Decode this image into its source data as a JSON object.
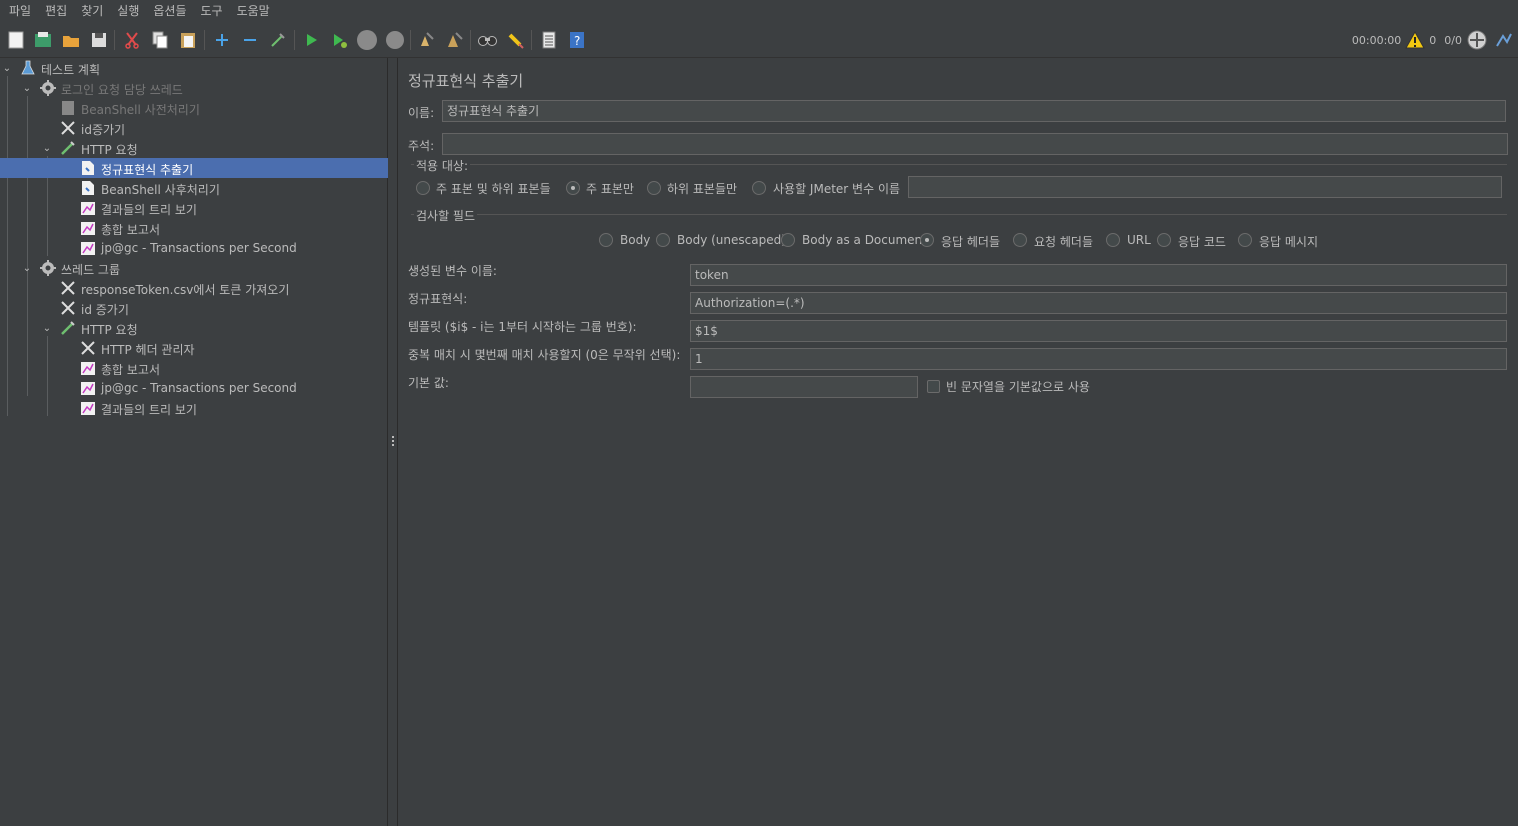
{
  "menu": [
    "파일",
    "편집",
    "찾기",
    "실행",
    "옵션들",
    "도구",
    "도움말"
  ],
  "status": {
    "timer": "00:00:00",
    "warnings": "0",
    "threads": "0/0"
  },
  "tree": [
    {
      "label": "테스트 계획",
      "icon": "flask-icon"
    },
    {
      "label": "로그인 요청 담당 쓰레드",
      "icon": "gear-icon"
    },
    {
      "label": "BeanShell 사전처리기",
      "icon": "script-icon"
    },
    {
      "label": "id증가기",
      "icon": "wrench-icon"
    },
    {
      "label": "HTTP 요청",
      "icon": "pipette-icon"
    },
    {
      "label": "정규표현식 추출기",
      "icon": "document-icon"
    },
    {
      "label": "BeanShell 사후처리기",
      "icon": "document-icon"
    },
    {
      "label": "결과들의 트리 보기",
      "icon": "chart-icon"
    },
    {
      "label": "총합 보고서",
      "icon": "chart-icon"
    },
    {
      "label": "jp@gc - Transactions per Second",
      "icon": "chart-icon"
    },
    {
      "label": "쓰레드 그룹",
      "icon": "gear-icon"
    },
    {
      "label": "responseToken.csv에서 토큰 가져오기",
      "icon": "wrench-icon"
    },
    {
      "label": "id 증가기",
      "icon": "wrench-icon"
    },
    {
      "label": "HTTP 요청",
      "icon": "pipette-icon"
    },
    {
      "label": "HTTP 헤더 관리자",
      "icon": "wrench-icon"
    },
    {
      "label": "총합 보고서",
      "icon": "chart-icon"
    },
    {
      "label": "jp@gc - Transactions per Second",
      "icon": "chart-icon"
    },
    {
      "label": "결과들의 트리 보기",
      "icon": "chart-icon"
    }
  ],
  "panel": {
    "title": "정규표현식 추출기",
    "name_label": "이름:",
    "name_value": "정규표현식 추출기",
    "comment_label": "주석:",
    "comment_value": "",
    "apply_to": {
      "legend": "적용 대상:",
      "options": [
        "주 표본 및 하위 표본들",
        "주 표본만",
        "하위 표본들만",
        "사용할 JMeter 변수 이름"
      ],
      "selected": "주 표본만",
      "var_value": ""
    },
    "field_to_check": {
      "legend": "검사할 필드",
      "options": [
        "Body",
        "Body (unescaped)",
        "Body as a Document",
        "응답 헤더들",
        "요청 헤더들",
        "URL",
        "응답 코드",
        "응답 메시지"
      ],
      "selected": "응답 헤더들"
    },
    "ref_name_label": "생성된 변수 이름:",
    "ref_name_value": "token",
    "regex_label": "정규표현식:",
    "regex_value": "Authorization=(.*)",
    "template_label": "템플릿 ($i$ - i는 1부터 시작하는 그룹 번호):",
    "template_value": "$1$",
    "match_no_label": "중복 매치 시 몇번째 매치 사용할지 (0은 무작위 선택):",
    "match_no_value": "1",
    "default_label": "기본 값:",
    "default_value": "",
    "empty_default_label": "빈 문자열을 기본값으로 사용",
    "empty_default_checked": false
  },
  "colors": {
    "background": "#3c3f41",
    "selection": "#4b6eaf",
    "field": "#45494a"
  }
}
